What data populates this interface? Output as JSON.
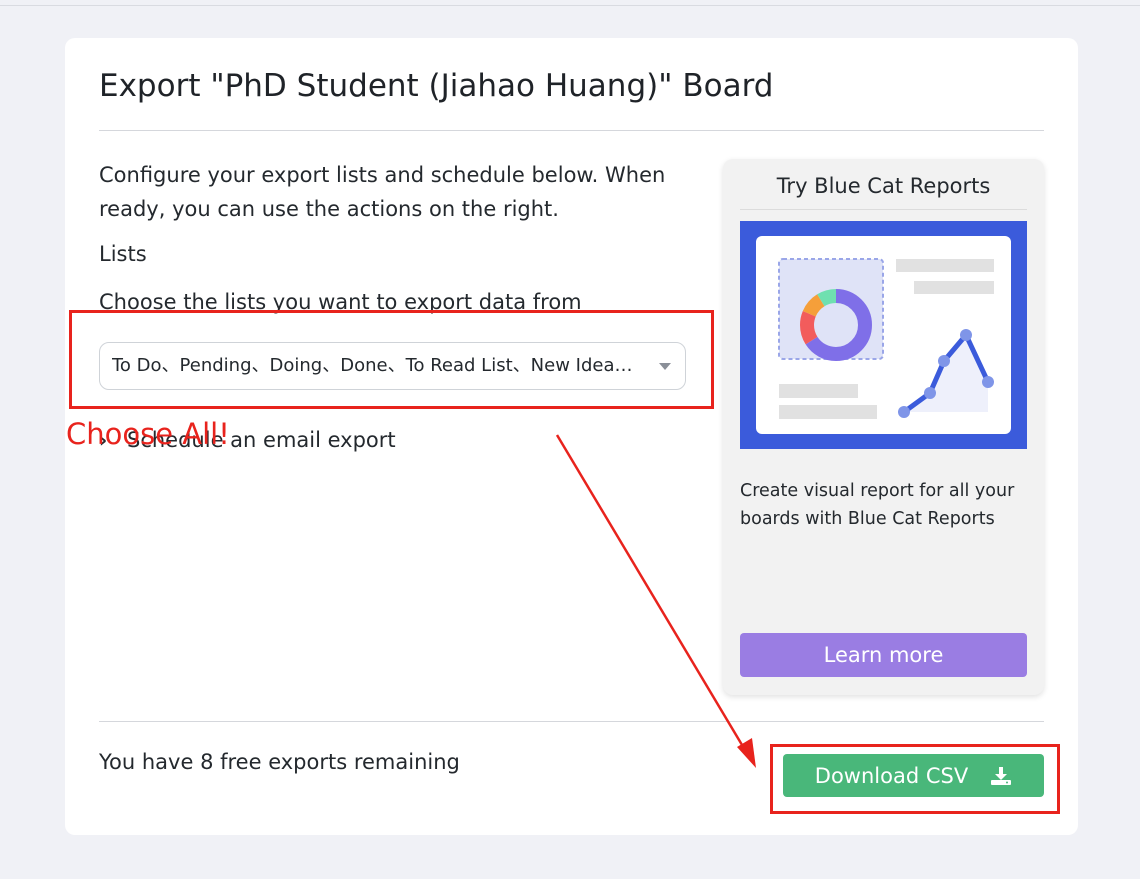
{
  "dialog": {
    "title": "Export \"PhD Student (Jiahao Huang)\" Board",
    "intro": "Configure your export lists and schedule below. When ready, you can use the actions on the right.",
    "lists_label": "Lists",
    "lists_help": "Choose the lists you want to export data from",
    "lists_select_value": "To Do、Pending、Doing、Done、To Read List、New Idea…",
    "schedule_label": "Schedule an email export",
    "remaining_text": "You have 8 free exports remaining",
    "download_label": "Download CSV"
  },
  "promo": {
    "title": "Try Blue Cat Reports",
    "description": "Create visual report for all your boards with Blue Cat Reports",
    "learn_more_label": "Learn more"
  },
  "annotation": {
    "note": "Choose All!",
    "color": "#e8231d"
  },
  "colors": {
    "download_green": "#49b77a",
    "learn_purple": "#9a7de3",
    "promo_blue": "#3b5bdb"
  }
}
